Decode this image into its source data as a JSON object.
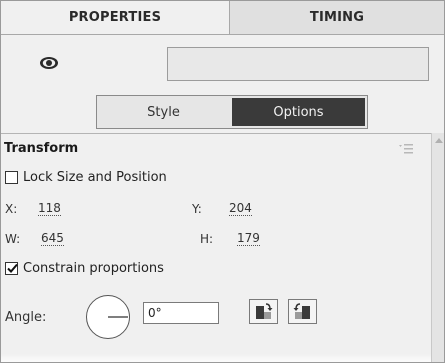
{
  "tabs": {
    "properties": "PROPERTIES",
    "timing": "TIMING"
  },
  "visibility": {
    "icon": "eye-icon",
    "name_value": ""
  },
  "segmented": {
    "style_label": "Style",
    "options_label": "Options",
    "selected": "Options"
  },
  "transform": {
    "title": "Transform",
    "menu_icon": "panel-menu-icon",
    "lock_label": "Lock Size and Position",
    "lock_checked": false,
    "x_label": "X:",
    "x_value": "118",
    "y_label": "Y:",
    "y_value": "204",
    "w_label": "W:",
    "w_value": "645",
    "h_label": "H:",
    "h_value": "179",
    "constrain_label": "Constrain proportions",
    "constrain_checked": true,
    "angle_label": "Angle:",
    "angle_value": "0°",
    "rotate_ccw_icon": "rotate-counterclockwise-icon",
    "rotate_cw_icon": "rotate-clockwise-icon"
  },
  "colors": {
    "panel_bg": "#f0f0f0",
    "active_segment": "#3a3a3a",
    "border": "#9a9a9a"
  }
}
